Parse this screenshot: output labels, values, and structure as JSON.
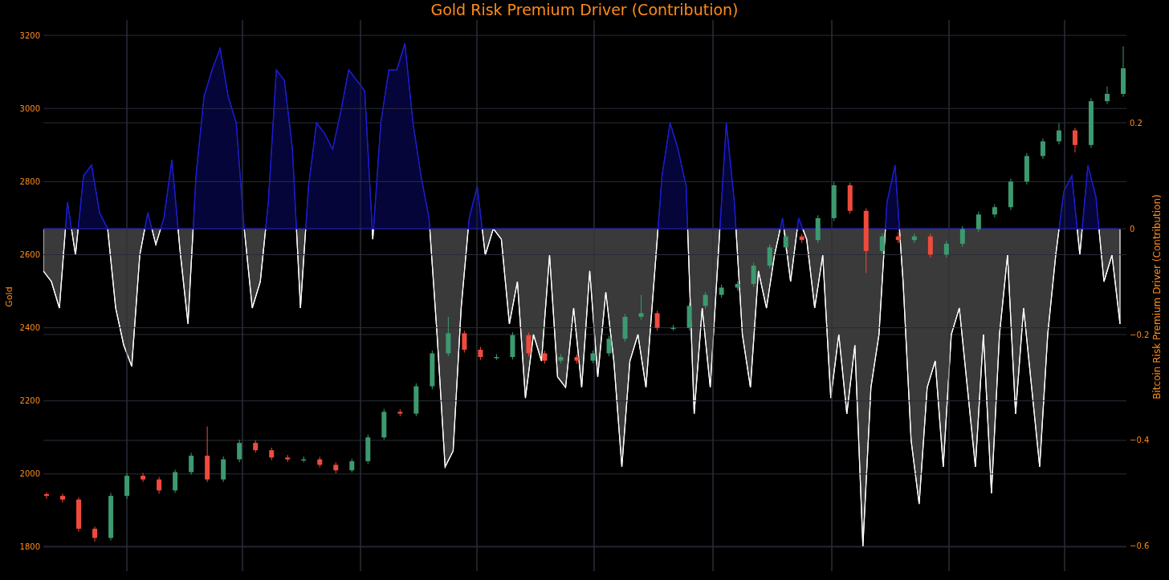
{
  "title": "Gold Risk Premium Driver (Contribution)",
  "driver_chart": {
    "chart_data": {
      "type": "area",
      "ylabel": "Bitcoin Risk Premium Driver (Contribution)",
      "grid": true,
      "ylim": [
        -0.647,
        0.394
      ],
      "yticks": [
        {
          "value": -0.6,
          "label": "−0.6"
        },
        {
          "value": -0.4,
          "label": "−0.4"
        },
        {
          "value": -0.2,
          "label": "−0.2"
        },
        {
          "value": 0,
          "label": "0"
        },
        {
          "value": 0.2,
          "label": "0.2"
        }
      ],
      "series": [
        {
          "color": "#1c1cd0",
          "values": [
            -0.08,
            -0.1,
            -0.15,
            0.05,
            -0.05,
            0.1,
            0.12,
            0.03,
            0,
            -0.15,
            -0.22,
            -0.26,
            -0.05,
            0.03,
            -0.03,
            0.02,
            0.13,
            -0.04,
            -0.18,
            0.1,
            0.25,
            0.3,
            0.34,
            0.25,
            0.2,
            0,
            -0.15,
            -0.1,
            0.05,
            0.3,
            0.28,
            0.15,
            -0.15,
            0.08,
            0.2,
            0.18,
            0.15,
            0.22,
            0.3,
            0.28,
            0.26,
            -0.02,
            0.2,
            0.3,
            0.3,
            0.35,
            0.2,
            0.1,
            0.02,
            -0.2,
            -0.45,
            -0.42,
            -0.15,
            0.02,
            0.08,
            -0.05,
            0,
            -0.02,
            -0.18,
            -0.1,
            -0.32,
            -0.2,
            -0.25,
            -0.05,
            -0.28,
            -0.3,
            -0.15,
            -0.3,
            -0.08,
            -0.28,
            -0.12,
            -0.25,
            -0.45,
            -0.25,
            -0.2,
            -0.3,
            -0.1,
            0.1,
            0.2,
            0.15,
            0.08,
            -0.35,
            -0.15,
            -0.3,
            -0.05,
            0.2,
            0.05,
            -0.2,
            -0.3,
            -0.08,
            -0.15,
            -0.05,
            0.02,
            -0.1,
            0.02,
            -0.02,
            -0.15,
            -0.05,
            -0.32,
            -0.2,
            -0.35,
            -0.22,
            -0.6,
            -0.3,
            -0.2,
            0.05,
            0.12,
            -0.1,
            -0.4,
            -0.52,
            -0.3,
            -0.25,
            -0.45,
            -0.2,
            -0.15,
            -0.3,
            -0.45,
            -0.2,
            -0.5,
            -0.2,
            -0.05,
            -0.35,
            -0.15,
            -0.3,
            -0.45,
            -0.2,
            -0.05,
            0.07,
            0.1,
            -0.05,
            0.12,
            0.06,
            -0.1,
            -0.05,
            -0.18
          ]
        }
      ]
    }
  },
  "gold_chart": {
    "chart_data": {
      "type": "candlestick",
      "ylabel": "Gold",
      "grid": true,
      "ylim": [
        1734,
        3242
      ],
      "yticks": [
        1800,
        2000,
        2200,
        2400,
        2600,
        2800,
        3000,
        3200
      ],
      "ohlc": [
        [
          1945,
          1950,
          1932,
          1940
        ],
        [
          1940,
          1946,
          1922,
          1930
        ],
        [
          1930,
          1936,
          1842,
          1850
        ],
        [
          1850,
          1856,
          1815,
          1825
        ],
        [
          1825,
          1948,
          1818,
          1940
        ],
        [
          1940,
          2002,
          1932,
          1995
        ],
        [
          1995,
          2003,
          1978,
          1985
        ],
        [
          1985,
          1992,
          1946,
          1955
        ],
        [
          1955,
          2012,
          1948,
          2005
        ],
        [
          2005,
          2058,
          1998,
          2050
        ],
        [
          2050,
          2130,
          1978,
          1985
        ],
        [
          1985,
          2048,
          1978,
          2040
        ],
        [
          2040,
          2094,
          2032,
          2085
        ],
        [
          2085,
          2092,
          2058,
          2065
        ],
        [
          2065,
          2072,
          2038,
          2045
        ],
        [
          2045,
          2052,
          2033,
          2040
        ],
        [
          2040,
          2048,
          2032,
          2040
        ],
        [
          2040,
          2047,
          2018,
          2025
        ],
        [
          2025,
          2032,
          2002,
          2010
        ],
        [
          2010,
          2042,
          2004,
          2035
        ],
        [
          2035,
          2108,
          2028,
          2100
        ],
        [
          2100,
          2178,
          2094,
          2170
        ],
        [
          2170,
          2177,
          2158,
          2165
        ],
        [
          2165,
          2248,
          2158,
          2240
        ],
        [
          2240,
          2338,
          2232,
          2330
        ],
        [
          2330,
          2430,
          2322,
          2385
        ],
        [
          2385,
          2392,
          2332,
          2340
        ],
        [
          2340,
          2348,
          2312,
          2320
        ],
        [
          2320,
          2328,
          2312,
          2320
        ],
        [
          2320,
          2388,
          2313,
          2380
        ],
        [
          2380,
          2387,
          2322,
          2330
        ],
        [
          2330,
          2337,
          2302,
          2310
        ],
        [
          2310,
          2328,
          2303,
          2320
        ],
        [
          2320,
          2327,
          2302,
          2310
        ],
        [
          2310,
          2338,
          2303,
          2330
        ],
        [
          2330,
          2378,
          2322,
          2370
        ],
        [
          2370,
          2438,
          2362,
          2430
        ],
        [
          2430,
          2490,
          2422,
          2440
        ],
        [
          2440,
          2447,
          2392,
          2400
        ],
        [
          2400,
          2408,
          2392,
          2400
        ],
        [
          2400,
          2468,
          2392,
          2460
        ],
        [
          2460,
          2498,
          2452,
          2490
        ],
        [
          2490,
          2518,
          2482,
          2510
        ],
        [
          2510,
          2528,
          2502,
          2520
        ],
        [
          2520,
          2578,
          2512,
          2570
        ],
        [
          2570,
          2628,
          2562,
          2620
        ],
        [
          2620,
          2658,
          2612,
          2650
        ],
        [
          2650,
          2657,
          2632,
          2640
        ],
        [
          2640,
          2708,
          2632,
          2700
        ],
        [
          2700,
          2800,
          2692,
          2790
        ],
        [
          2790,
          2797,
          2712,
          2720
        ],
        [
          2720,
          2727,
          2550,
          2610
        ],
        [
          2610,
          2658,
          2602,
          2650
        ],
        [
          2650,
          2662,
          2632,
          2640
        ],
        [
          2640,
          2658,
          2632,
          2650
        ],
        [
          2650,
          2657,
          2592,
          2600
        ],
        [
          2600,
          2638,
          2592,
          2630
        ],
        [
          2630,
          2678,
          2622,
          2670
        ],
        [
          2670,
          2718,
          2662,
          2710
        ],
        [
          2710,
          2738,
          2702,
          2730
        ],
        [
          2730,
          2808,
          2722,
          2800
        ],
        [
          2800,
          2878,
          2792,
          2870
        ],
        [
          2870,
          2918,
          2862,
          2910
        ],
        [
          2910,
          2960,
          2902,
          2940
        ],
        [
          2940,
          2947,
          2880,
          2900
        ],
        [
          2900,
          3028,
          2892,
          3020
        ],
        [
          3020,
          3060,
          3012,
          3040
        ],
        [
          3040,
          3170,
          3032,
          3110
        ]
      ]
    }
  }
}
